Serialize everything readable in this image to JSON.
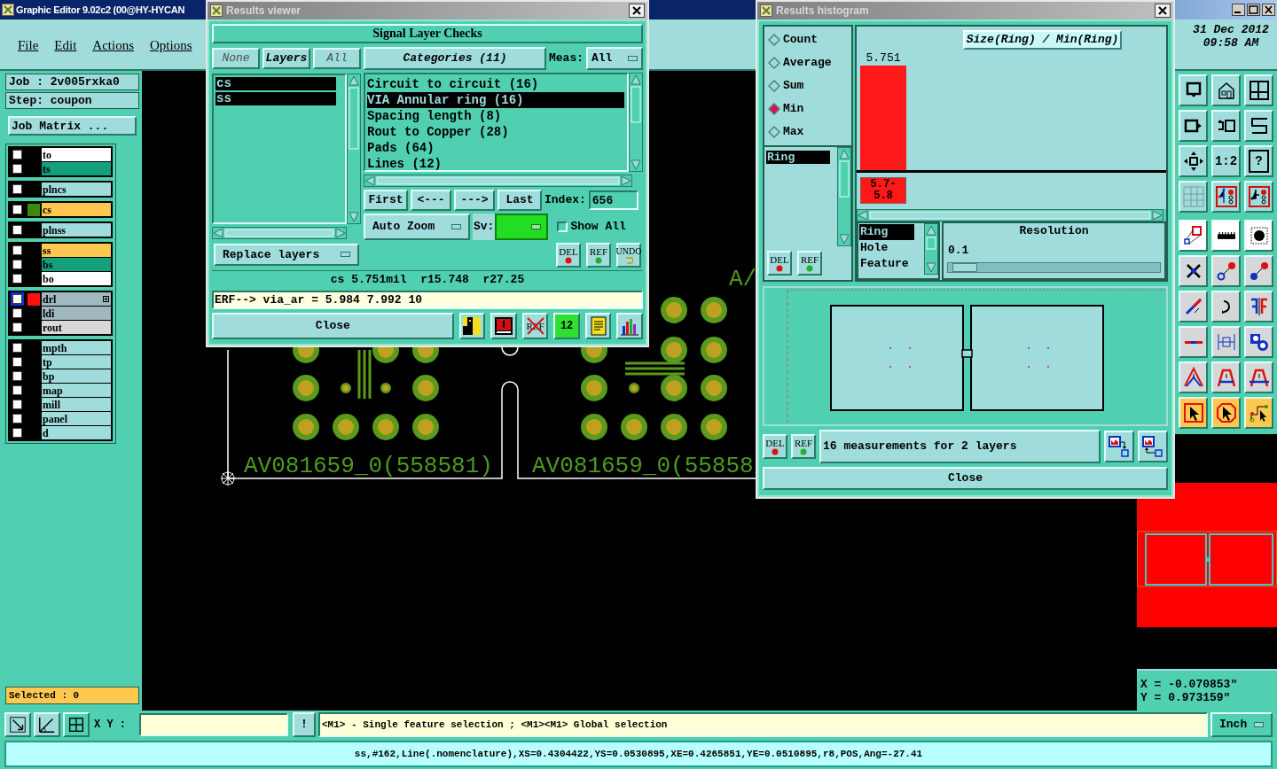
{
  "main_window": {
    "title": "Graphic Editor 9.02c2 (00@HY-HYCAN",
    "menu": [
      "File",
      "Edit",
      "Actions",
      "Options"
    ],
    "date": "31 Dec 2012",
    "time": "09:58 AM"
  },
  "job_panel": {
    "job": "Job : 2v005rxka0",
    "step": "Step: coupon",
    "matrix_button": "Job Matrix ...",
    "layer_groups": [
      {
        "layers": [
          {
            "name": "to",
            "color": "#ffffff",
            "checked": false,
            "selected": false,
            "expandable": false
          },
          {
            "name": "ts",
            "color": "#14a07c",
            "checked": false,
            "selected": false,
            "expandable": false
          }
        ]
      },
      {
        "layers": [
          {
            "name": "plncs",
            "color": "#a0dcdc",
            "checked": false,
            "selected": false,
            "expandable": false
          }
        ]
      },
      {
        "layers": [
          {
            "name": "cs",
            "color": "#ffc850",
            "swatch": {
              "color": "#3a8a10"
            },
            "checked": false,
            "selected": false,
            "expandable": false
          }
        ]
      },
      {
        "layers": [
          {
            "name": "plnss",
            "color": "#a0dcdc",
            "checked": false,
            "selected": false,
            "expandable": false
          }
        ]
      },
      {
        "layers": [
          {
            "name": "ss",
            "color": "#ffc850",
            "checked": false,
            "selected": false,
            "expandable": false
          },
          {
            "name": "bs",
            "color": "#14a07c",
            "checked": false,
            "selected": false,
            "expandable": false
          },
          {
            "name": "bo",
            "color": "#ffffff",
            "checked": false,
            "selected": false,
            "expandable": false
          }
        ]
      },
      {
        "layers": [
          {
            "name": "drl",
            "color": "#a0b8c0",
            "swatch": {
              "color": "#ff1010"
            },
            "checked": false,
            "selected": true,
            "expandable": true
          },
          {
            "name": "ldi",
            "color": "#a0b8c0",
            "checked": false,
            "selected": false,
            "expandable": false
          },
          {
            "name": "rout",
            "color": "#d8d8d8",
            "checked": false,
            "selected": false,
            "expandable": false
          }
        ]
      },
      {
        "layers": [
          {
            "name": "mpth",
            "color": "#a0dcdc",
            "checked": false,
            "selected": false,
            "expandable": false
          },
          {
            "name": "tp",
            "color": "#a0dcdc",
            "checked": false,
            "selected": false,
            "expandable": false
          },
          {
            "name": "bp",
            "color": "#a0dcdc",
            "checked": false,
            "selected": false,
            "expandable": false
          },
          {
            "name": "map",
            "color": "#a0dcdc",
            "checked": false,
            "selected": false,
            "expandable": false
          },
          {
            "name": "mill",
            "color": "#a0dcdc",
            "checked": false,
            "selected": false,
            "expandable": false
          },
          {
            "name": "panel",
            "color": "#a0dcdc",
            "checked": false,
            "selected": false,
            "expandable": false
          },
          {
            "name": "d",
            "color": "#a0dcdc",
            "checked": false,
            "selected": false,
            "expandable": false
          }
        ]
      }
    ],
    "selected_count": "Selected : 0"
  },
  "canvas": {
    "labels": [
      "A/",
      "AV081659_0(558581)",
      "AV081659_0(55858"
    ]
  },
  "results_viewer": {
    "title": "Results viewer",
    "header": "Signal Layer Checks",
    "layer_buttons": [
      "None",
      "Layers",
      "All"
    ],
    "layers": [
      {
        "label": "cs",
        "selected": true
      },
      {
        "label": "ss",
        "selected": true
      }
    ],
    "replace_button": "Replace layers",
    "categories_button": "Categories (11)",
    "meas_label": "Meas:",
    "meas_value": "All",
    "categories": [
      {
        "label": "Circuit to circuit (16)",
        "selected": false
      },
      {
        "label": "VIA Annular ring (16)",
        "selected": true
      },
      {
        "label": "Spacing length (8)",
        "selected": false
      },
      {
        "label": "Rout to Copper (28)",
        "selected": false
      },
      {
        "label": "Pads (64)",
        "selected": false
      },
      {
        "label": "Lines (12)",
        "selected": false
      }
    ],
    "nav_buttons": [
      "First",
      "<---",
      "--->",
      "Last"
    ],
    "index_label": "Index:",
    "index_value": "656",
    "auto_zoom": "Auto Zoom",
    "sv_label": "Sv:",
    "show_all": {
      "label": "Show All",
      "checked": false
    },
    "action_buttons": [
      "DEL",
      "REF",
      "UNDO"
    ],
    "measurement": "cs 5.751mil  r15.748  r27.25",
    "erf_line": "ERF--> via_ar = 5.984 7.992 10",
    "close": "Close",
    "tool_labels": [
      "REF",
      "12"
    ]
  },
  "histogram": {
    "title": "Results histogram",
    "modes": [
      {
        "label": "Count",
        "selected": false
      },
      {
        "label": "Average",
        "selected": false
      },
      {
        "label": "Sum",
        "selected": false
      },
      {
        "label": "Min",
        "selected": true
      },
      {
        "label": "Max",
        "selected": false
      }
    ],
    "chart": {
      "title": "Size(Ring) / Min(Ring)",
      "bars": [
        {
          "value_label": "5.751",
          "bin_label": "5.7-5.8"
        }
      ]
    },
    "ring_list": [
      {
        "label": "Ring",
        "selected": true
      }
    ],
    "fields": [
      {
        "label": "Ring",
        "selected": true
      },
      {
        "label": "Hole",
        "selected": false
      },
      {
        "label": "Feature",
        "selected": false
      }
    ],
    "resolution_label": "Resolution",
    "resolution_value": "0.1",
    "resolution": {
      "level": 0.02
    },
    "action_buttons": [
      "DEL",
      "REF"
    ],
    "bottom_buttons": [
      "DEL",
      "REF"
    ],
    "summary": "16 measurements for 2 layers",
    "close": "Close"
  },
  "toolbar": {
    "text_buttons": [
      "1:2",
      "?"
    ]
  },
  "coordinates": [
    "X = -0.070853\"",
    "Y = 0.973159\""
  ],
  "command_bar": {
    "xy_label": "X Y :",
    "bang": "!",
    "prompt": "<M1> - Single feature selection ; <M1><M1> Global selection",
    "units": "Inch"
  },
  "status_line": "ss,#162,Line(.nomenclature),XS=0.4304422,YS=0.0530895,XE=0.4265851,YE=0.0510895,r8,POS,Ang=-27.41"
}
